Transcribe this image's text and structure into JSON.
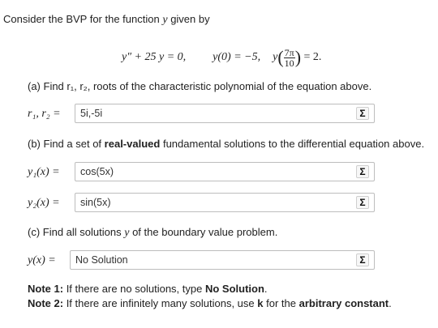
{
  "intro": {
    "prefix": "Consider the BVP for the function",
    "var": "y",
    "suffix": "given by"
  },
  "equation": {
    "ode": "y″ + 25 y = 0,",
    "bc1": "y(0) = −5,",
    "bc2_pre": "y",
    "bc2_num": "7π",
    "bc2_den": "10",
    "bc2_post": "= 2."
  },
  "part_a": {
    "prompt": "(a) Find r₁, r₂, roots of the characteristic polynomial of the equation above.",
    "label": "r₁, r₂ =",
    "answer": "5i,-5i"
  },
  "part_b": {
    "prompt_pre": "(b) Find a set of",
    "prompt_bold": "real-valued",
    "prompt_post": "fundamental solutions to the differential equation above.",
    "y1_label": "y₁(x) =",
    "y1_answer": "cos(5x)",
    "y2_label": "y₂(x) =",
    "y2_answer": "sin(5x)"
  },
  "part_c": {
    "prompt_pre": "(c) Find all solutions",
    "prompt_var": "y",
    "prompt_post": "of the boundary value problem.",
    "label": "y(x) =",
    "answer": "No Solution"
  },
  "notes": {
    "note1_label": "Note 1:",
    "note1_text": "If there are no solutions, type",
    "note1_bold": "No Solution",
    "note1_end": ".",
    "note2_label": "Note 2:",
    "note2_text": "If there are infinitely many solutions, use",
    "note2_k": "k",
    "note2_mid": "for the",
    "note2_bold": "arbitrary constant",
    "note2_end": "."
  },
  "sigma_icon": "Σ"
}
